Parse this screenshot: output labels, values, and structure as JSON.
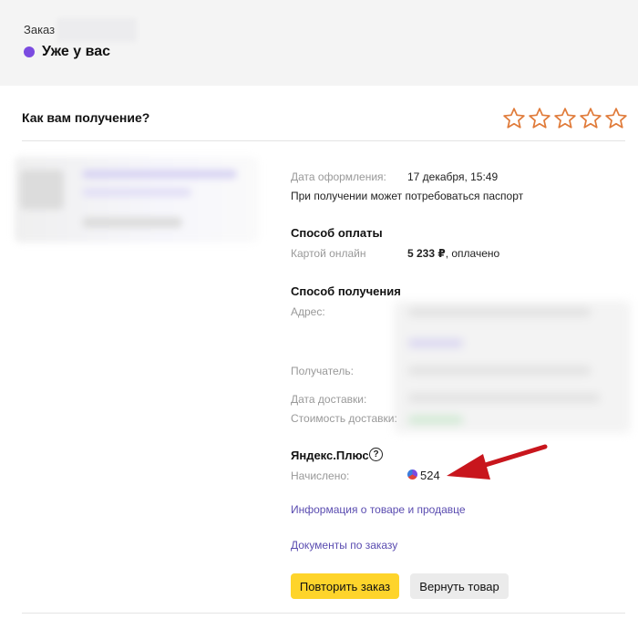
{
  "header": {
    "order_label": "Заказ",
    "status": "Уже у вас",
    "status_color": "#7b4be0"
  },
  "rating": {
    "question": "Как вам получение?",
    "stars_total": 5,
    "star_color": "#e07b3a"
  },
  "details": {
    "date_label": "Дата оформления:",
    "date_value": "17 декабря, 15:49",
    "passport_note": "При получении может потребоваться паспорт"
  },
  "payment": {
    "title": "Способ оплаты",
    "method_label": "Картой онлайн",
    "amount": "5 233 ₽",
    "status_suffix": ", оплачено"
  },
  "delivery": {
    "title": "Способ получения",
    "address_label": "Адрес:",
    "recipient_label": "Получатель:",
    "date_label": "Дата доставки:",
    "cost_label": "Стоимость доставки:"
  },
  "plus": {
    "title": "Яндекс.Плюс",
    "help_glyph": "?",
    "accrued_label": "Начислено:",
    "accrued_value": "524",
    "arrow_color": "#c8161d"
  },
  "links": {
    "product_info": "Информация о товаре и продавце",
    "documents": "Документы по заказу"
  },
  "buttons": {
    "repeat": "Повторить заказ",
    "return": "Вернуть товар",
    "accent": "#fed42b"
  }
}
